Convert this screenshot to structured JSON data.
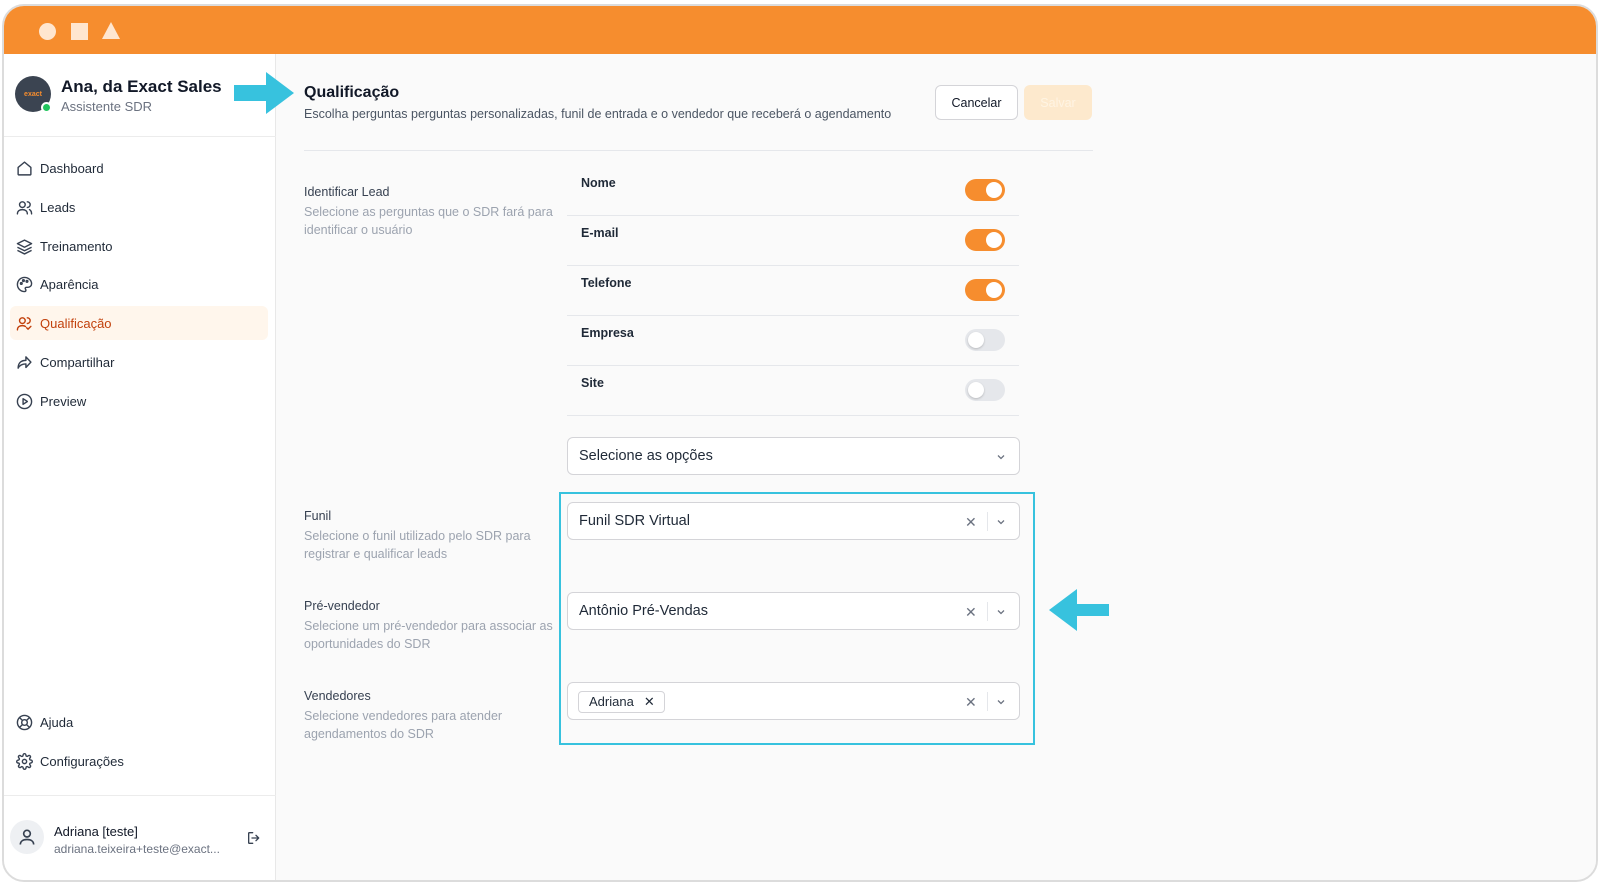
{
  "colors": {
    "accent": "#f68d2e",
    "highlight": "#37c2de"
  },
  "assistant": {
    "name": "Ana, da Exact Sales",
    "role": "Assistente SDR",
    "logo_text": "exact"
  },
  "nav": {
    "items": [
      {
        "label": "Dashboard",
        "icon": "home-icon"
      },
      {
        "label": "Leads",
        "icon": "users-icon"
      },
      {
        "label": "Treinamento",
        "icon": "layers-icon"
      },
      {
        "label": "Aparência",
        "icon": "palette-icon"
      },
      {
        "label": "Qualificação",
        "icon": "user-check-icon",
        "active": true
      },
      {
        "label": "Compartilhar",
        "icon": "share-icon"
      },
      {
        "label": "Preview",
        "icon": "play-circle-icon"
      }
    ],
    "bottom": [
      {
        "label": "Ajuda",
        "icon": "lifebuoy-icon"
      },
      {
        "label": "Configurações",
        "icon": "gear-icon"
      }
    ]
  },
  "user": {
    "name": "Adriana [teste]",
    "email": "adriana.teixeira+teste@exact..."
  },
  "header": {
    "title": "Qualificação",
    "subtitle": "Escolha perguntas perguntas personalizadas, funil de entrada e o vendedor que receberá o agendamento",
    "cancel_label": "Cancelar",
    "save_label": "Salvar"
  },
  "identify": {
    "label": "Identificar Lead",
    "description": "Selecione as perguntas que o SDR fará para identificar o usuário",
    "questions": [
      {
        "label": "Nome",
        "enabled": true
      },
      {
        "label": "E-mail",
        "enabled": true
      },
      {
        "label": "Telefone",
        "enabled": true
      },
      {
        "label": "Empresa",
        "enabled": false
      },
      {
        "label": "Site",
        "enabled": false
      }
    ],
    "options_placeholder": "Selecione as opções"
  },
  "funnel": {
    "label": "Funil",
    "description": "Selecione o funil utilizado pelo SDR para registrar e qualificar leads",
    "value": "Funil SDR Virtual"
  },
  "presales": {
    "label": "Pré-vendedor",
    "description": "Selecione um pré-vendedor para associar as oportunidades do SDR",
    "value": "Antônio Pré-Vendas"
  },
  "sellers": {
    "label": "Vendedores",
    "description": "Selecione vendedores para atender agendamentos do SDR",
    "tags": [
      "Adriana"
    ]
  }
}
